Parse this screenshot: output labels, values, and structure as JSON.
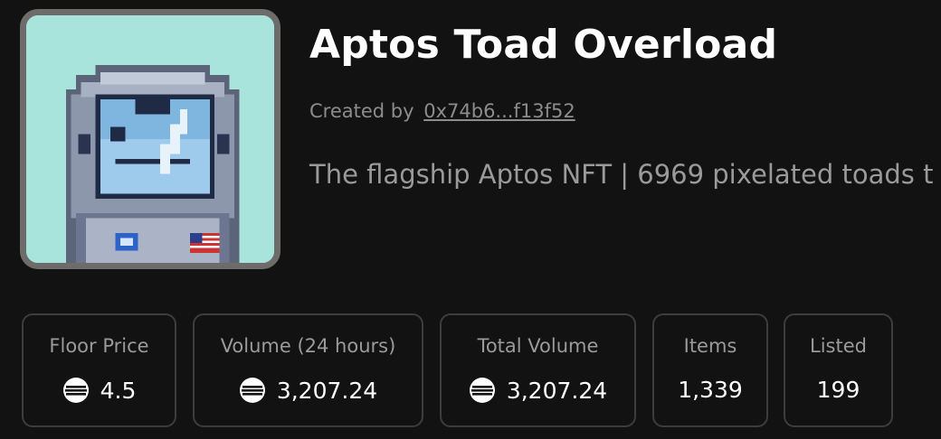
{
  "collection": {
    "title": "Aptos Toad Overload",
    "created_by_label": "Created by",
    "creator_address": "0x74b6...f13f52",
    "description": "The flagship Aptos NFT | 6969 pixelated toads t",
    "avatar_icon": "astronaut-toad-pixel-avatar"
  },
  "stats": [
    {
      "label": "Floor Price",
      "value": "4.5",
      "icon": "aptos-coin-icon"
    },
    {
      "label": "Volume (24 hours)",
      "value": "3,207.24",
      "icon": "aptos-coin-icon"
    },
    {
      "label": "Total Volume",
      "value": "3,207.24",
      "icon": "aptos-coin-icon"
    },
    {
      "label": "Items",
      "value": "1,339"
    },
    {
      "label": "Listed",
      "value": "199"
    }
  ],
  "colors": {
    "background": "#121212",
    "card_border": "#3d3d3d",
    "muted_text": "#9a9a9a",
    "avatar_bg": "#a9e4dc"
  }
}
